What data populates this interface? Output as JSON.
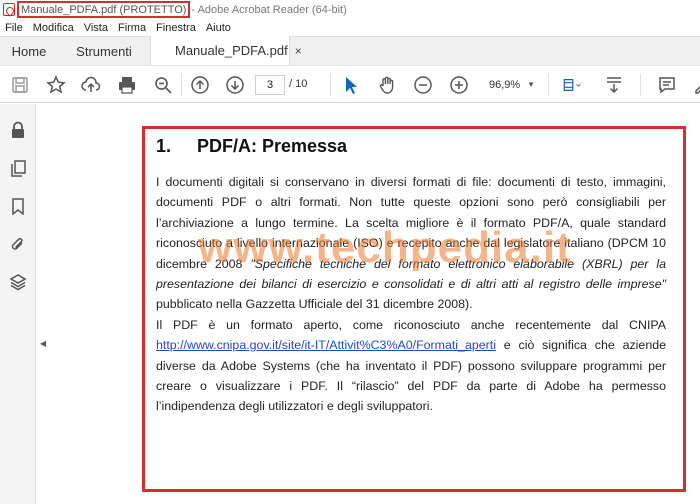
{
  "window": {
    "file_title": "Manuale_PDFA.pdf (PROTETTO)",
    "app_title": "- Adobe Acrobat Reader (64-bit)"
  },
  "menu": [
    "File",
    "Modifica",
    "Vista",
    "Firma",
    "Finestra",
    "Aiuto"
  ],
  "tabs": {
    "home": "Home",
    "tools": "Strumenti",
    "document": "Manuale_PDFA.pdf",
    "close_glyph": "×"
  },
  "toolbar": {
    "current_page": "3",
    "total_pages": "/ 10",
    "zoom": "96,9%",
    "icons": [
      "save-icon",
      "star-icon",
      "upload-cloud-icon",
      "print-icon",
      "find-icon",
      "page-up-icon",
      "page-down-icon",
      "select-arrow-icon",
      "hand-icon",
      "zoom-out-icon",
      "zoom-in-icon",
      "fit-page-icon",
      "scroll-mode-icon",
      "comment-icon",
      "sign-icon"
    ]
  },
  "sidebar": {
    "icons": [
      "lock-icon",
      "pages-icon",
      "bookmark-icon",
      "attachment-icon",
      "layers-icon"
    ]
  },
  "document": {
    "heading_number": "1.",
    "heading_title": "PDF/A: Premessa",
    "para1_a": "I documenti digitali si conservano in diversi formati di file: documenti di testo, immagini, documenti PDF o altri formati. Non tutte queste opzioni sono però consigliabili per l’archiviazione a lungo termine. La scelta migliore è il formato PDF/A, quale standard riconosciuto a livello internazionale (ISO) e recepito anche dal legislatore italiano (DPCM 10 dicembre 2008 ",
    "para1_italic": "\"Specifiche tecniche del formato elettronico elaborabile (XBRL) per la presentazione dei bilanci di esercizio e consolidati e di altri atti al registro delle imprese\"",
    "para1_b": " pubblicato nella Gazzetta Ufficiale del 31 dicembre 2008).",
    "para2_a": "Il PDF è un formato aperto, come riconosciuto anche recentemente dal CNIPA ",
    "para2_link": "http://www.cnipa.gov.it/site/it-IT/Attivit%C3%A0/Formati_aperti",
    "para2_b": " e ciò significa che aziende diverse da Adobe Systems (che ha inventato il PDF) possono sviluppare programmi per creare o visualizzare i PDF. Il “rilascio” del PDF da parte di Adobe ha permesso l’indipendenza degli utilizzatori e degli sviluppatori."
  },
  "watermark": "www.techpedia.it",
  "colors": {
    "highlight_red": "#d32f2f",
    "link_blue": "#1a4fbf",
    "watermark_orange": "#ed782d"
  }
}
